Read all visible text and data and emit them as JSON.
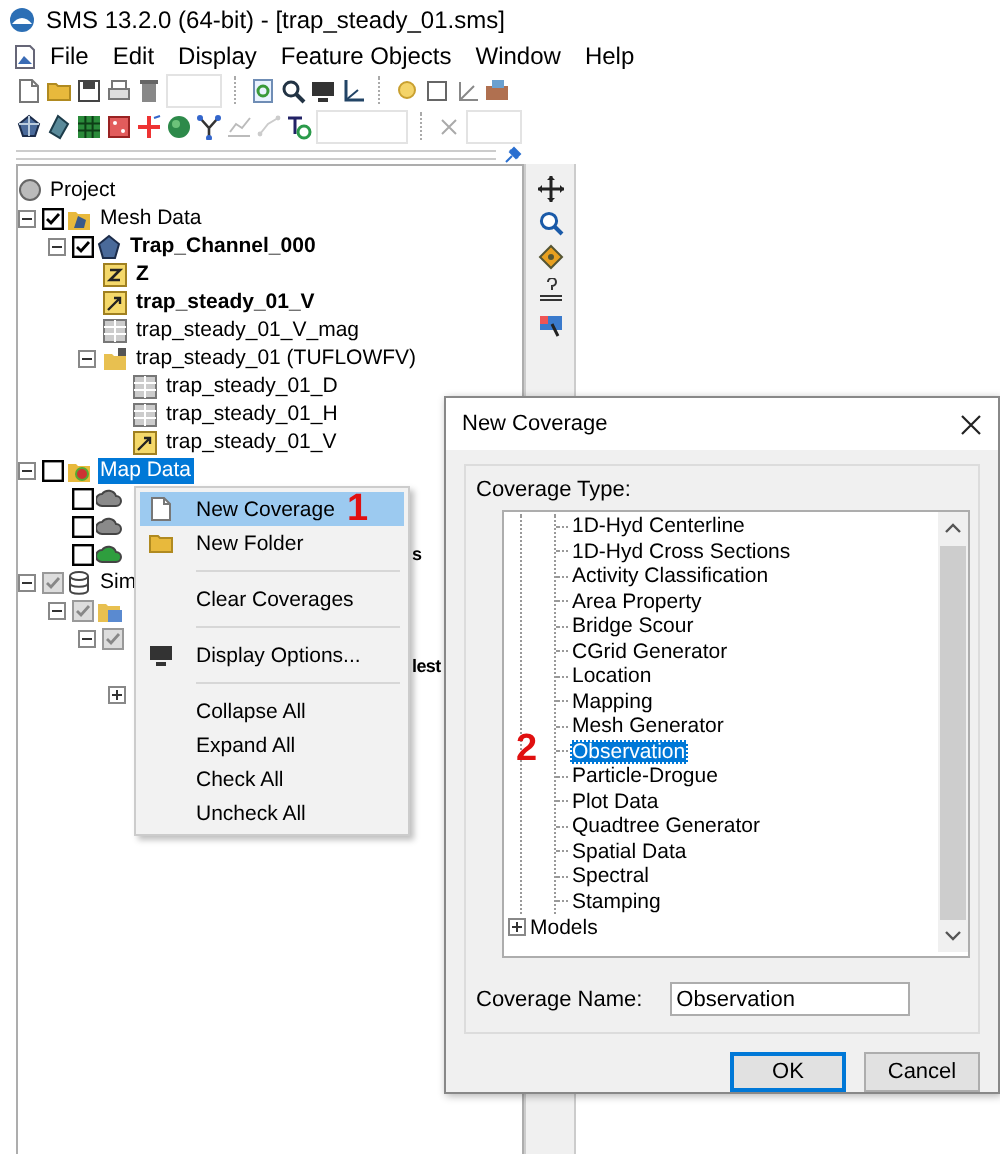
{
  "window": {
    "title": "SMS 13.2.0 (64-bit) - [trap_steady_01.sms]"
  },
  "menu_bar": [
    {
      "label": "File"
    },
    {
      "label": "Edit"
    },
    {
      "label": "Display"
    },
    {
      "label": "Feature Objects"
    },
    {
      "label": "Window"
    },
    {
      "label": "Help"
    }
  ],
  "project_tree": {
    "root": "Project",
    "items": [
      {
        "label": "Mesh Data",
        "kind": "mesh-folder",
        "checked": true,
        "expanded": true,
        "children": [
          {
            "label": "Trap_Channel_000",
            "kind": "mesh",
            "checked": true,
            "bold": true,
            "expanded": true,
            "children": [
              {
                "label": "Z",
                "kind": "scalar",
                "bold": true
              },
              {
                "label": "trap_steady_01_V",
                "kind": "vector",
                "bold": true
              },
              {
                "label": "trap_steady_01_V_mag",
                "kind": "table"
              },
              {
                "label": "trap_steady_01 (TUFLOWFV)",
                "kind": "locked-folder",
                "expanded": true,
                "children": [
                  {
                    "label": "trap_steady_01_D",
                    "kind": "table"
                  },
                  {
                    "label": "trap_steady_01_H",
                    "kind": "table"
                  },
                  {
                    "label": "trap_steady_01_V",
                    "kind": "vector"
                  }
                ]
              }
            ]
          }
        ]
      },
      {
        "label": "Map Data",
        "kind": "map-folder",
        "checked": false,
        "selected": true,
        "expanded": true,
        "children": [
          {
            "kind": "coverage",
            "checked": false,
            "color": "#8a8a8a"
          },
          {
            "kind": "coverage",
            "checked": false,
            "color": "#8a8a8a"
          },
          {
            "label": "s",
            "kind": "coverage",
            "checked": false,
            "color": "#2e9e3e",
            "bold": true,
            "covered": true
          }
        ]
      },
      {
        "label": "Sim",
        "kind": "database",
        "checked": true,
        "disabled": true,
        "expanded": true,
        "children": [
          {
            "kind": "sim-folder",
            "checked": true,
            "disabled": true,
            "expanded": true,
            "children": [
              {
                "kind": "sim-item",
                "checked": true,
                "disabled": true,
                "expanded": true,
                "children": [
                  {
                    "label": "lest",
                    "kind": "sim-item",
                    "bold": true,
                    "covered": true
                  },
                  {
                    "kind": "sim-item",
                    "expanded": false
                  }
                ]
              }
            ]
          }
        ]
      }
    ]
  },
  "context_menu": {
    "items": [
      {
        "label": "New Coverage",
        "selected": true,
        "callout": "1"
      },
      {
        "label": "New Folder",
        "selected": false
      },
      {
        "label": "Clear Coverages",
        "selected": false,
        "separator_before": true
      },
      {
        "label": "Display Options...",
        "selected": false,
        "separator_before": true
      },
      {
        "label": "Collapse All",
        "selected": false,
        "separator_before": true
      },
      {
        "label": "Expand All",
        "selected": false
      },
      {
        "label": "Check All",
        "selected": false
      },
      {
        "label": "Uncheck All",
        "selected": false
      }
    ]
  },
  "dialog": {
    "title": "New Coverage",
    "group_label": "Coverage Type:",
    "types": [
      {
        "label": "1D-Hyd Centerline",
        "selected": false
      },
      {
        "label": "1D-Hyd Cross Sections",
        "selected": false
      },
      {
        "label": "Activity Classification",
        "selected": false
      },
      {
        "label": "Area Property",
        "selected": false
      },
      {
        "label": "Bridge Scour",
        "selected": false
      },
      {
        "label": "CGrid Generator",
        "selected": false
      },
      {
        "label": "Location",
        "selected": false
      },
      {
        "label": "Mapping",
        "selected": false
      },
      {
        "label": "Mesh Generator",
        "selected": false
      },
      {
        "label": "Observation",
        "selected": true,
        "callout": "2"
      },
      {
        "label": "Particle-Drogue",
        "selected": false
      },
      {
        "label": "Plot Data",
        "selected": false
      },
      {
        "label": "Quadtree Generator",
        "selected": false
      },
      {
        "label": "Spatial Data",
        "selected": false
      },
      {
        "label": "Spectral",
        "selected": false
      },
      {
        "label": "Stamping",
        "selected": false
      }
    ],
    "folders": [
      {
        "label": "Models",
        "expanded": false
      }
    ],
    "name_label": "Coverage Name:",
    "name_value": "Observation",
    "buttons": [
      {
        "label": "OK",
        "default": true
      },
      {
        "label": "Cancel",
        "default": false
      }
    ]
  }
}
